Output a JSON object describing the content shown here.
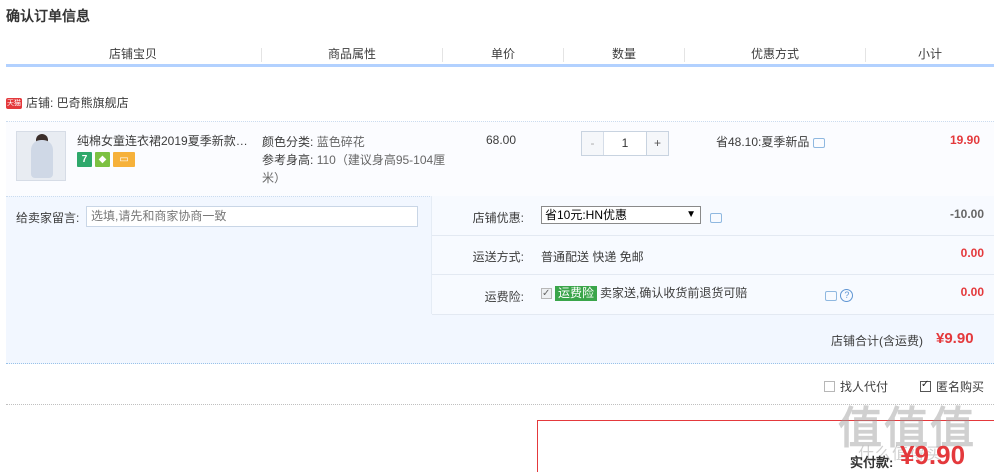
{
  "page_title": "确认订单信息",
  "columns": [
    "店铺宝贝",
    "商品属性",
    "单价",
    "数量",
    "优惠方式",
    "小计"
  ],
  "shop": {
    "badge": "天猫",
    "label": "店铺: 巴奇熊旗舰店"
  },
  "item": {
    "title": "纯棉女童连衣裙2019夏季新款…",
    "service_icons": [
      "seven-day-icon",
      "leaf-icon",
      "card-icon"
    ],
    "attr_color_key": "颜色分类:",
    "attr_color_val": "蓝色碎花",
    "attr_height_key": "参考身高:",
    "attr_height_val": "110（建议身高95-104厘米）",
    "price": "68.00",
    "qty_minus": "-",
    "qty_value": "1",
    "qty_plus": "+",
    "promo": "省48.10:夏季新品",
    "subtotal": "19.90"
  },
  "message": {
    "label": "给卖家留言:",
    "placeholder": "选填,请先和商家协商一致"
  },
  "shop_coupon": {
    "label": "店铺优惠:",
    "selected": "省10元:HN优惠",
    "amount": "-10.00"
  },
  "shipping": {
    "label": "运送方式:",
    "value": "普通配送 快递 免邮",
    "amount": "0.00"
  },
  "insurance": {
    "label": "运费险:",
    "badge": "运费险",
    "text": "卖家送,确认收货前退货可赔",
    "amount": "0.00"
  },
  "shop_total": {
    "label": "店铺合计(含运费)",
    "value": "¥9.90"
  },
  "options": {
    "proxy_label": "找人代付",
    "anon_label": "匿名购买"
  },
  "payment": {
    "label": "实付款:",
    "value": "¥9.90"
  },
  "watermark": {
    "big": "值值值",
    "small": "什么值得买"
  },
  "colors": {
    "accent_red": "#e4393c",
    "header_rule": "#b2d1ff",
    "panel_bg": "#f2f7ff",
    "green_badge": "#3aa54a"
  }
}
